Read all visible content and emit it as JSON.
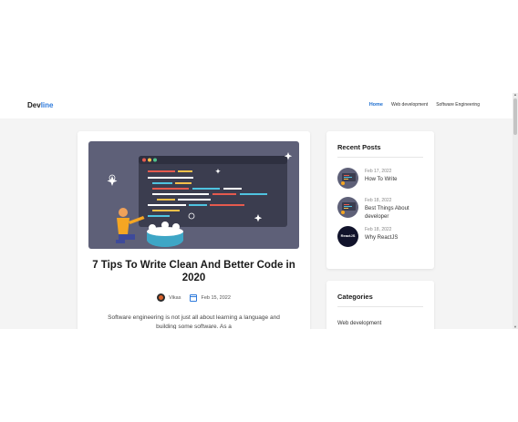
{
  "navbar": {
    "brand_part1": "Dev",
    "brand_part2": "line",
    "links": [
      "Home",
      "Web development",
      "Software Engineering"
    ]
  },
  "post": {
    "title": "7 Tips To Write Clean And Better Code in 2020",
    "author": "Vikas",
    "date": "Feb 15, 2022",
    "excerpt": "Software engineering is not just all about learning a language and building some software. As a"
  },
  "recent_posts": {
    "title": "Recent Posts",
    "items": [
      {
        "date": "Feb 17, 2022",
        "title": "How To Write",
        "thumb": "code-illustration"
      },
      {
        "date": "Feb 18, 2022",
        "title": "Best Things About developer",
        "thumb": "code-illustration"
      },
      {
        "date": "Feb 18, 2022",
        "title": "Why ReactJS",
        "thumb": "react-logo",
        "thumb_text": "ReactJS"
      }
    ]
  },
  "categories": {
    "title": "Categories",
    "items": [
      "Web development"
    ]
  },
  "colors": {
    "accent": "#2f7bdc",
    "illustration_bg": "#5e6078",
    "page_bg": "#f4f4f4"
  }
}
